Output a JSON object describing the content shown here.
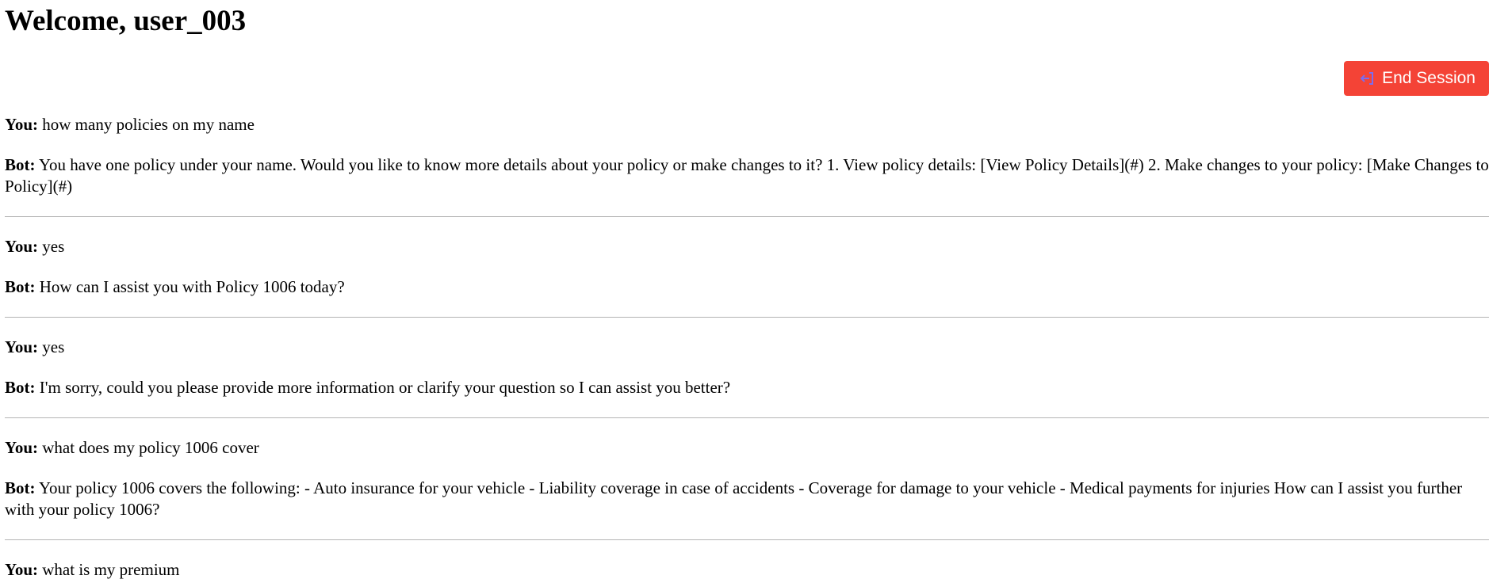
{
  "header": {
    "welcome": "Welcome, user_003"
  },
  "toolbar": {
    "end_session_label": "End Session",
    "end_session_icon": "exit-icon",
    "end_session_color": "#f44336"
  },
  "chat": {
    "you_label": "You:",
    "bot_label": "Bot:",
    "exchanges": [
      {
        "you": "how many policies on my name",
        "bot": "You have one policy under your name. Would you like to know more details about your policy or make changes to it? 1. View policy details: [View Policy Details](#) 2. Make changes to your policy: [Make Changes to Policy](#)"
      },
      {
        "you": "yes",
        "bot": "How can I assist you with Policy 1006 today?"
      },
      {
        "you": "yes",
        "bot": "I'm sorry, could you please provide more information or clarify your question so I can assist you better?"
      },
      {
        "you": "what does my policy 1006 cover",
        "bot": "Your policy 1006 covers the following: - Auto insurance for your vehicle - Liability coverage in case of accidents - Coverage for damage to your vehicle - Medical payments for injuries How can I assist you further with your policy 1006?"
      },
      {
        "you": "what is my premium",
        "bot": ""
      }
    ]
  }
}
